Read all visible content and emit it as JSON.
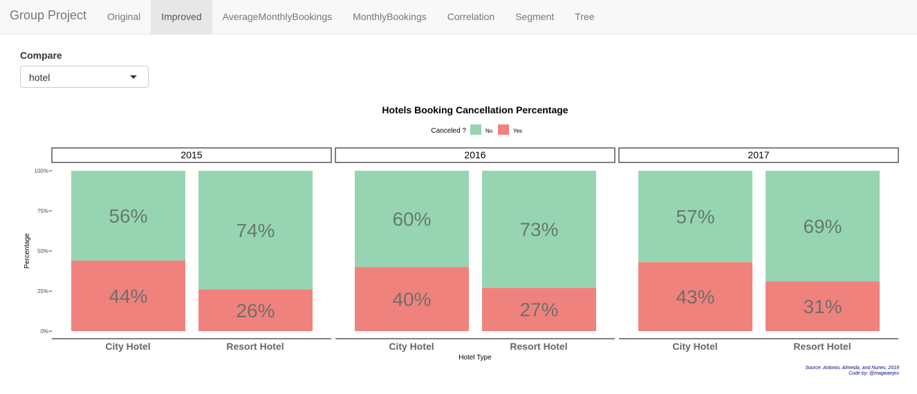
{
  "app": {
    "brand": "Group Project",
    "tabs": [
      {
        "label": "Original",
        "active": false
      },
      {
        "label": "Improved",
        "active": true
      },
      {
        "label": "AverageMonthlyBookings",
        "active": false
      },
      {
        "label": "MonthlyBookings",
        "active": false
      },
      {
        "label": "Correlation",
        "active": false
      },
      {
        "label": "Segment",
        "active": false
      },
      {
        "label": "Tree",
        "active": false
      }
    ]
  },
  "controls": {
    "compare_label": "Compare",
    "compare_value": "hotel"
  },
  "chart_data": {
    "type": "bar",
    "stacked": true,
    "title": "Hotels Booking Cancellation Percentage",
    "xlabel": "Hotel Type",
    "ylabel": "Percentage",
    "ylim": [
      0,
      100
    ],
    "yticks": [
      "0%",
      "25%",
      "50%",
      "75%",
      "100%"
    ],
    "legend": {
      "title": "Canceled ?",
      "position": "top",
      "entries": [
        {
          "name": "No",
          "color": "#97d5b2"
        },
        {
          "name": "Yes",
          "color": "#f0827e"
        }
      ]
    },
    "facets": [
      {
        "label": "2015",
        "categories": [
          "City Hotel",
          "Resort Hotel"
        ],
        "no": [
          56,
          74
        ],
        "yes": [
          44,
          26
        ]
      },
      {
        "label": "2016",
        "categories": [
          "City Hotel",
          "Resort Hotel"
        ],
        "no": [
          60,
          73
        ],
        "yes": [
          40,
          27
        ]
      },
      {
        "label": "2017",
        "categories": [
          "City Hotel",
          "Resort Hotel"
        ],
        "no": [
          57,
          69
        ],
        "yes": [
          43,
          31
        ]
      }
    ],
    "caption": [
      "Source: Antonio, Almeida, and Nunes, 2019",
      "Code by: @magwanjiru"
    ],
    "caption_color": "#00008b",
    "grid": false
  }
}
